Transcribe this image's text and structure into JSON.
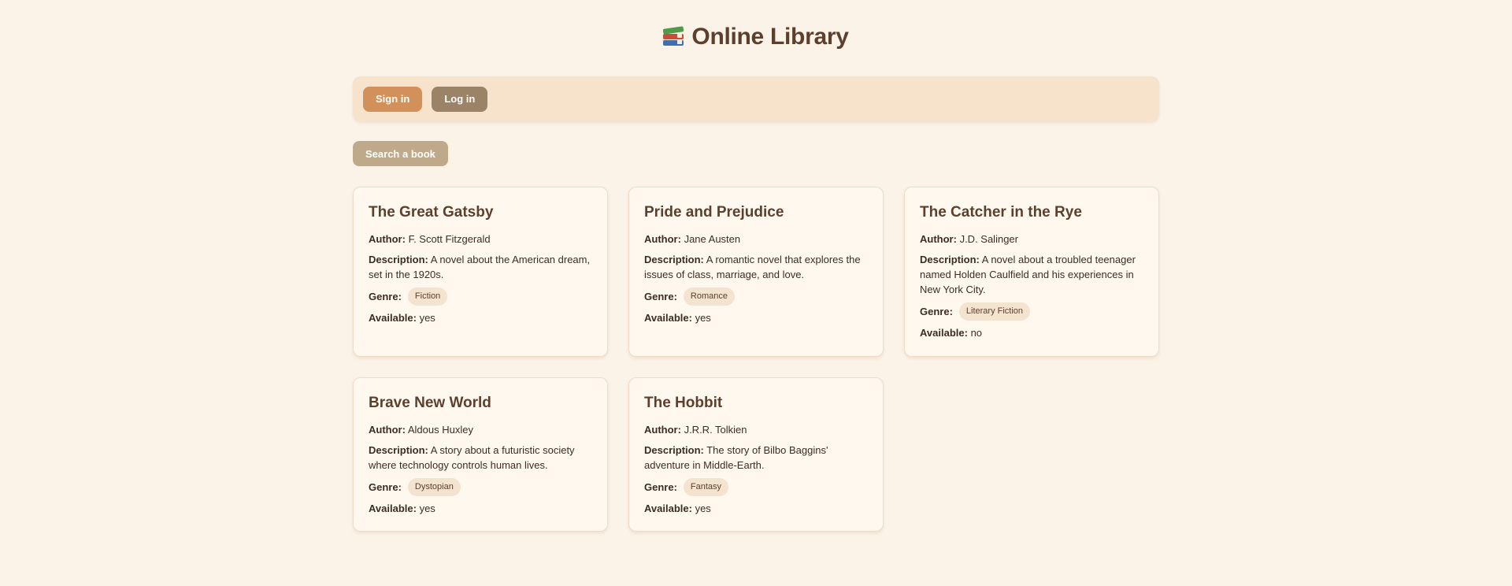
{
  "header": {
    "icon": "books-icon",
    "title": "Online Library"
  },
  "nav": {
    "sign_in": "Sign in",
    "log_in": "Log in"
  },
  "search": {
    "label": "Search a book"
  },
  "labels": {
    "author": "Author:",
    "description": "Description:",
    "genre": "Genre:",
    "available": "Available:"
  },
  "books": [
    {
      "title": "The Great Gatsby",
      "author": "F. Scott Fitzgerald",
      "description": "A novel about the American dream, set in the 1920s.",
      "genre": "Fiction",
      "available": "yes"
    },
    {
      "title": "Pride and Prejudice",
      "author": "Jane Austen",
      "description": "A romantic novel that explores the issues of class, marriage, and love.",
      "genre": "Romance",
      "available": "yes"
    },
    {
      "title": "The Catcher in the Rye",
      "author": "J.D. Salinger",
      "description": "A novel about a troubled teenager named Holden Caulfield and his experiences in New York City.",
      "genre": "Literary Fiction",
      "available": "no"
    },
    {
      "title": "Brave New World",
      "author": "Aldous Huxley",
      "description": "A story about a futuristic society where technology controls human lives.",
      "genre": "Dystopian",
      "available": "yes"
    },
    {
      "title": "The Hobbit",
      "author": "J.R.R. Tolkien",
      "description": "The story of Bilbo Baggins' adventure in Middle-Earth.",
      "genre": "Fantasy",
      "available": "yes"
    }
  ],
  "colors": {
    "background": "#fcf3e8",
    "title": "#5c3f2c",
    "sign_in_button": "#d2905a",
    "log_in_button": "#9a8366",
    "search_button": "#bfa98b",
    "navbar": "#f7e3cb",
    "genre_tag": "#f3e3cf"
  }
}
